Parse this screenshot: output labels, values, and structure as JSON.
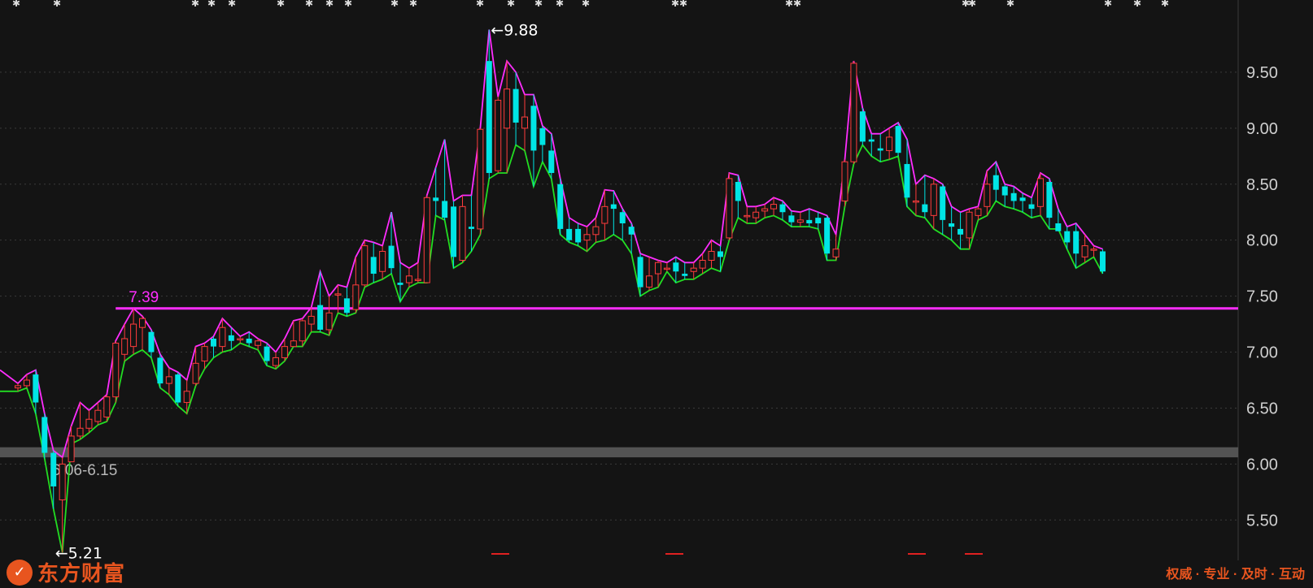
{
  "brand": {
    "name": "东方财富",
    "slogan": "权威 · 专业 · 及时 · 互动",
    "color": "#e8551f"
  },
  "colors": {
    "up": "#ff3c3c",
    "down": "#00e5e5",
    "upper_band": "#ff2dff",
    "lower_band": "#22dd22",
    "ref_line": "#ff2dff",
    "zone": "#5a5a5a",
    "grid": "#3a3a3a",
    "axis_text": "#cfcfcf"
  },
  "chart_data": {
    "type": "candlestick",
    "y_ticks": [
      "9.50",
      "9.00",
      "8.50",
      "8.00",
      "7.50",
      "7.00",
      "6.50",
      "6.00",
      "5.50"
    ],
    "ylim": [
      5.27,
      10.0
    ],
    "grid": "dotted horizontal",
    "annotations": {
      "high": "9.88",
      "low": "5.21",
      "ref_label": "7.39",
      "zone_label": "6.06-6.15"
    },
    "ref_line": 7.39,
    "zone": [
      6.06,
      6.15
    ],
    "high": {
      "index": 53,
      "value": 9.88
    },
    "low": {
      "index": 4,
      "value": 5.21
    },
    "candles": [
      [
        6.68,
        6.7,
        6.72,
        6.65
      ],
      [
        6.7,
        6.75,
        6.8,
        6.68
      ],
      [
        6.8,
        6.55,
        6.84,
        6.45
      ],
      [
        6.42,
        6.1,
        6.45,
        6.05
      ],
      [
        6.1,
        5.8,
        6.12,
        5.6
      ],
      [
        5.68,
        6.0,
        6.06,
        5.21
      ],
      [
        6.02,
        6.25,
        6.34,
        6.18
      ],
      [
        6.25,
        6.32,
        6.55,
        6.22
      ],
      [
        6.32,
        6.4,
        6.48,
        6.28
      ],
      [
        6.38,
        6.48,
        6.55,
        6.35
      ],
      [
        6.42,
        6.6,
        6.62,
        6.38
      ],
      [
        6.6,
        7.08,
        7.1,
        6.55
      ],
      [
        6.98,
        7.12,
        7.25,
        6.92
      ],
      [
        7.05,
        7.25,
        7.39,
        6.98
      ],
      [
        7.22,
        7.3,
        7.32,
        7.02
      ],
      [
        7.18,
        7.0,
        7.2,
        6.95
      ],
      [
        6.95,
        6.72,
        6.98,
        6.68
      ],
      [
        6.72,
        6.78,
        6.86,
        6.62
      ],
      [
        6.8,
        6.55,
        6.82,
        6.52
      ],
      [
        6.55,
        6.65,
        6.75,
        6.45
      ],
      [
        6.72,
        6.9,
        7.05,
        6.7
      ],
      [
        6.92,
        7.05,
        7.08,
        6.85
      ],
      [
        7.12,
        7.05,
        7.14,
        6.95
      ],
      [
        7.05,
        7.22,
        7.3,
        7.0
      ],
      [
        7.15,
        7.1,
        7.22,
        7.02
      ],
      [
        7.12,
        7.12,
        7.14,
        7.08
      ],
      [
        7.12,
        7.08,
        7.18,
        7.05
      ],
      [
        7.06,
        7.1,
        7.12,
        7.02
      ],
      [
        7.05,
        6.92,
        7.08,
        6.88
      ],
      [
        6.88,
        6.95,
        7.0,
        6.85
      ],
      [
        6.95,
        7.05,
        7.12,
        6.92
      ],
      [
        7.05,
        7.1,
        7.28,
        7.05
      ],
      [
        7.1,
        7.28,
        7.3,
        7.05
      ],
      [
        7.25,
        7.32,
        7.4,
        7.18
      ],
      [
        7.42,
        7.2,
        7.72,
        7.18
      ],
      [
        7.2,
        7.35,
        7.5,
        7.15
      ],
      [
        7.52,
        7.52,
        7.6,
        7.35
      ],
      [
        7.48,
        7.35,
        7.58,
        7.32
      ],
      [
        7.38,
        7.6,
        7.85,
        7.35
      ],
      [
        7.6,
        7.95,
        8.0,
        7.58
      ],
      [
        7.85,
        7.7,
        7.98,
        7.62
      ],
      [
        7.72,
        7.9,
        7.95,
        7.65
      ],
      [
        7.95,
        7.75,
        8.25,
        7.7
      ],
      [
        7.62,
        7.6,
        7.8,
        7.45
      ],
      [
        7.62,
        7.68,
        7.75,
        7.58
      ],
      [
        7.65,
        7.65,
        7.8,
        7.62
      ],
      [
        7.62,
        8.38,
        8.4,
        7.62
      ],
      [
        8.38,
        8.35,
        8.65,
        8.22
      ],
      [
        8.35,
        8.2,
        8.9,
        8.18
      ],
      [
        8.3,
        7.85,
        8.35,
        7.75
      ],
      [
        7.82,
        8.3,
        8.4,
        7.8
      ],
      [
        8.12,
        8.1,
        8.4,
        7.9
      ],
      [
        8.1,
        8.99,
        9.0,
        8.05
      ],
      [
        9.6,
        8.6,
        9.88,
        8.55
      ],
      [
        8.62,
        9.25,
        9.28,
        8.6
      ],
      [
        9.0,
        9.35,
        9.6,
        8.6
      ],
      [
        9.35,
        9.05,
        9.5,
        8.85
      ],
      [
        9.0,
        9.1,
        9.3,
        8.8
      ],
      [
        9.2,
        8.8,
        9.3,
        8.48
      ],
      [
        9.0,
        8.85,
        9.02,
        8.7
      ],
      [
        8.8,
        8.6,
        8.95,
        8.55
      ],
      [
        8.5,
        8.1,
        8.55,
        8.05
      ],
      [
        8.1,
        8.0,
        8.2,
        7.98
      ],
      [
        8.1,
        7.98,
        8.15,
        7.95
      ],
      [
        8.0,
        8.05,
        8.12,
        7.9
      ],
      [
        8.05,
        8.12,
        8.2,
        7.98
      ],
      [
        8.15,
        8.3,
        8.45,
        8.0
      ],
      [
        8.32,
        8.28,
        8.44,
        8.05
      ],
      [
        8.25,
        8.15,
        8.28,
        8.0
      ],
      [
        8.12,
        8.05,
        8.15,
        7.88
      ],
      [
        7.85,
        7.58,
        7.88,
        7.5
      ],
      [
        7.58,
        7.68,
        7.85,
        7.55
      ],
      [
        7.7,
        7.8,
        7.82,
        7.58
      ],
      [
        7.75,
        7.75,
        7.8,
        7.72
      ],
      [
        7.8,
        7.72,
        7.85,
        7.62
      ],
      [
        7.7,
        7.68,
        7.8,
        7.65
      ],
      [
        7.72,
        7.75,
        7.8,
        7.65
      ],
      [
        7.75,
        7.82,
        7.88,
        7.7
      ],
      [
        7.82,
        7.9,
        8.0,
        7.75
      ],
      [
        7.9,
        7.85,
        7.95,
        7.72
      ],
      [
        8.02,
        8.55,
        8.6,
        8.0
      ],
      [
        8.52,
        8.35,
        8.58,
        8.2
      ],
      [
        8.22,
        8.22,
        8.3,
        8.15
      ],
      [
        8.2,
        8.25,
        8.3,
        8.15
      ],
      [
        8.26,
        8.28,
        8.32,
        8.2
      ],
      [
        8.28,
        8.32,
        8.38,
        8.22
      ],
      [
        8.32,
        8.25,
        8.35,
        8.18
      ],
      [
        8.22,
        8.16,
        8.26,
        8.12
      ],
      [
        8.16,
        8.18,
        8.25,
        8.12
      ],
      [
        8.18,
        8.15,
        8.28,
        8.12
      ],
      [
        8.2,
        8.15,
        8.25,
        8.1
      ],
      [
        8.2,
        7.88,
        8.22,
        7.82
      ],
      [
        7.85,
        7.92,
        8.05,
        7.82
      ],
      [
        8.35,
        8.7,
        8.72,
        8.3
      ],
      [
        8.7,
        9.58,
        9.6,
        8.68
      ],
      [
        9.15,
        8.88,
        9.18,
        8.85
      ],
      [
        8.9,
        8.88,
        8.95,
        8.75
      ],
      [
        8.82,
        8.8,
        8.95,
        8.7
      ],
      [
        8.8,
        8.92,
        9.0,
        8.72
      ],
      [
        9.02,
        8.78,
        9.05,
        8.75
      ],
      [
        8.68,
        8.38,
        8.9,
        8.3
      ],
      [
        8.35,
        8.35,
        8.5,
        8.22
      ],
      [
        8.32,
        8.25,
        8.58,
        8.2
      ],
      [
        8.22,
        8.5,
        8.55,
        8.1
      ],
      [
        8.48,
        8.18,
        8.5,
        8.05
      ],
      [
        8.15,
        8.12,
        8.3,
        8.0
      ],
      [
        8.1,
        8.05,
        8.25,
        7.92
      ],
      [
        8.02,
        8.25,
        8.28,
        7.92
      ],
      [
        8.22,
        8.28,
        8.3,
        8.18
      ],
      [
        8.3,
        8.5,
        8.62,
        8.22
      ],
      [
        8.58,
        8.45,
        8.7,
        8.35
      ],
      [
        8.48,
        8.4,
        8.5,
        8.3
      ],
      [
        8.42,
        8.35,
        8.48,
        8.28
      ],
      [
        8.38,
        8.35,
        8.42,
        8.25
      ],
      [
        8.32,
        8.28,
        8.38,
        8.2
      ],
      [
        8.3,
        8.55,
        8.6,
        8.22
      ],
      [
        8.52,
        8.2,
        8.55,
        8.1
      ],
      [
        8.15,
        8.08,
        8.28,
        8.1
      ],
      [
        8.08,
        7.98,
        8.12,
        7.92
      ],
      [
        8.08,
        7.88,
        8.15,
        7.75
      ],
      [
        7.85,
        7.95,
        8.05,
        7.8
      ],
      [
        7.92,
        7.92,
        7.95,
        7.85
      ],
      [
        7.9,
        7.72,
        7.92,
        7.7
      ]
    ]
  }
}
